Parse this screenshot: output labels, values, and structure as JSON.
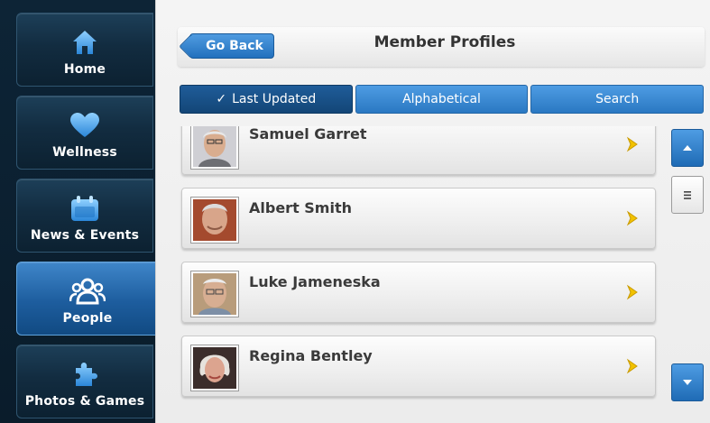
{
  "sidebar": {
    "items": [
      {
        "label": "Home",
        "icon": "home-icon",
        "active": false
      },
      {
        "label": "Wellness",
        "icon": "heart-icon",
        "active": false
      },
      {
        "label": "News & Events",
        "icon": "calendar-icon",
        "active": false
      },
      {
        "label": "People",
        "icon": "people-icon",
        "active": true
      },
      {
        "label": "Photos & Games",
        "icon": "puzzle-icon",
        "active": false
      }
    ]
  },
  "header": {
    "back_label": "Go Back",
    "title": "Member Profiles"
  },
  "tabs": [
    {
      "label": "Last Updated",
      "selected": true,
      "icon": "check-icon"
    },
    {
      "label": "Alphabetical",
      "selected": false
    },
    {
      "label": "Search",
      "selected": false
    }
  ],
  "members": [
    {
      "name": "Samuel Garret",
      "icon": "avatar"
    },
    {
      "name": "Albert Smith",
      "icon": "avatar"
    },
    {
      "name": "Luke Jameneska",
      "icon": "avatar"
    },
    {
      "name": "Regina Bentley",
      "icon": "avatar"
    }
  ],
  "colors": {
    "accent": "#2a78c2",
    "selected_tab": "#134677",
    "sidebar_bg": "#0d2436",
    "chevron": "#f2c200"
  }
}
